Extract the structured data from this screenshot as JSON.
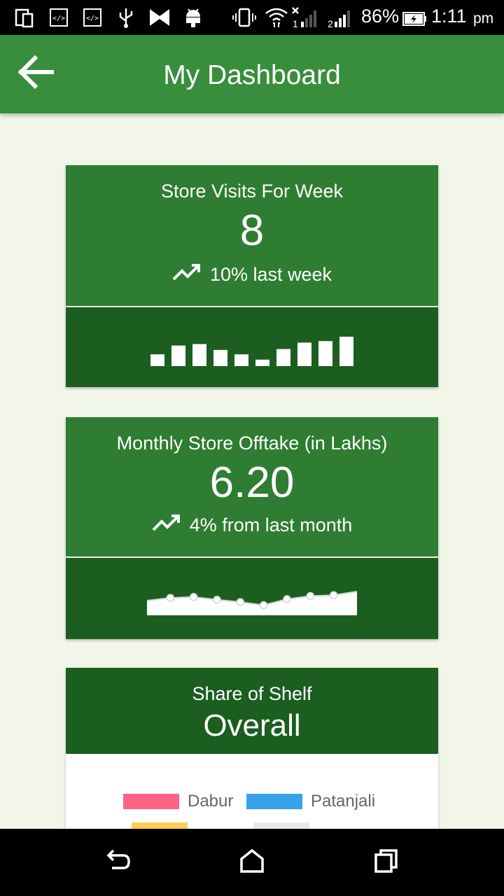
{
  "status_bar": {
    "battery_percent": "86%",
    "time": "1:11",
    "ampm": "pm",
    "sim1_label": "1",
    "sim2_label": "2"
  },
  "app_bar": {
    "title": "My Dashboard"
  },
  "store_visits": {
    "label": "Store Visits For Week",
    "value": "8",
    "trend_text": "10% last week",
    "bars": [
      0.4,
      0.7,
      0.75,
      0.55,
      0.4,
      0.22,
      0.58,
      0.8,
      0.85,
      1.0
    ]
  },
  "offtake": {
    "label": "Monthly Store Offtake (in Lakhs)",
    "value": "6.20",
    "trend_text": "4% from last month",
    "points": [
      0.5,
      0.65,
      0.7,
      0.55,
      0.42,
      0.25,
      0.58,
      0.75,
      0.8,
      1.0
    ]
  },
  "share_of_shelf": {
    "title": "Share of Shelf",
    "subtitle": "Overall",
    "legend": [
      {
        "label": "Dabur",
        "color": "#ff6384"
      },
      {
        "label": "Patanjali",
        "color": "#36a2eb"
      },
      {
        "label": "",
        "color": "#ffce56"
      },
      {
        "label": "",
        "color": "#e8e8e8"
      }
    ]
  },
  "colors": {
    "app_bar": "#388e3c",
    "card_top": "#2e7d32",
    "card_bottom": "#1b5e20",
    "background": "#f1f6e9"
  }
}
